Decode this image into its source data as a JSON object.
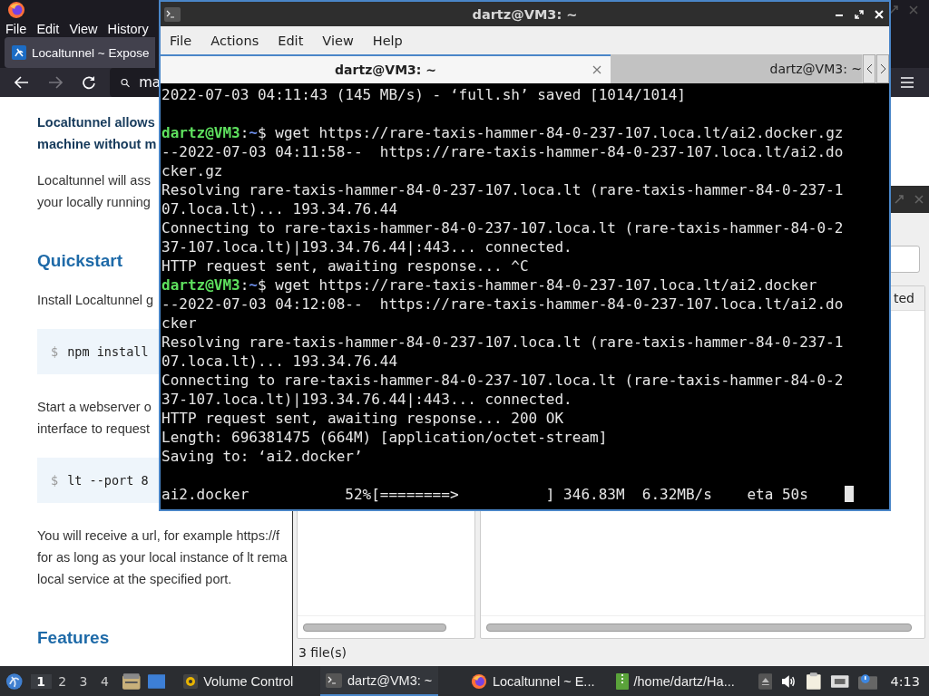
{
  "browser": {
    "menu": [
      "File",
      "Edit",
      "View",
      "History"
    ],
    "tab": {
      "title": "Localtunnel ~ Expose",
      "selected": true
    },
    "address": {
      "value": "ma"
    },
    "content": [
      {
        "kind": "lead",
        "lines": [
          "Localtunnel allows",
          "machine without m"
        ]
      },
      {
        "kind": "para",
        "lines": [
          "Localtunnel will ass",
          "your locally running"
        ]
      },
      {
        "kind": "heading",
        "text": "Quickstart"
      },
      {
        "kind": "para",
        "lines": [
          "Install Localtunnel g"
        ]
      },
      {
        "kind": "code",
        "prompt": "$",
        "text": "npm install"
      },
      {
        "kind": "para",
        "lines": [
          "Start a webserver o",
          "interface to request"
        ]
      },
      {
        "kind": "code",
        "prompt": "$",
        "text": "lt --port 8"
      },
      {
        "kind": "para",
        "lines": [
          "You will receive a url, for example https://f",
          "for as long as your local instance of lt rema",
          "local service at the specified port."
        ]
      },
      {
        "kind": "heading",
        "text": "Features"
      }
    ]
  },
  "file_manager": {
    "column_header": "ted",
    "status": "3 file(s)"
  },
  "terminal": {
    "title": "dartz@VM3: ~",
    "menu": [
      "File",
      "Actions",
      "Edit",
      "View",
      "Help"
    ],
    "tabs": [
      {
        "label": "dartz@VM3: ~",
        "selected": true
      },
      {
        "label": "dartz@VM3: ~",
        "selected": false
      }
    ],
    "cursor_visible": true,
    "lines": [
      {
        "kind": "text",
        "text": "2022-07-03 04:11:43 (145 MB/s) - ‘full.sh’ saved [1014/1014]"
      },
      {
        "kind": "blank"
      },
      {
        "kind": "prompt",
        "user": "dartz@VM3",
        "separator": ":",
        "path": "~",
        "symbol": "$",
        "command": "wget https://rare-taxis-hammer-84-0-237-107.loca.lt/ai2.docker.gz"
      },
      {
        "kind": "text",
        "text": "--2022-07-03 04:11:58--  https://rare-taxis-hammer-84-0-237-107.loca.lt/ai2.do"
      },
      {
        "kind": "text",
        "text": "cker.gz"
      },
      {
        "kind": "text",
        "text": "Resolving rare-taxis-hammer-84-0-237-107.loca.lt (rare-taxis-hammer-84-0-237-1"
      },
      {
        "kind": "text",
        "text": "07.loca.lt)... 193.34.76.44"
      },
      {
        "kind": "text",
        "text": "Connecting to rare-taxis-hammer-84-0-237-107.loca.lt (rare-taxis-hammer-84-0-2"
      },
      {
        "kind": "text",
        "text": "37-107.loca.lt)|193.34.76.44|:443... connected."
      },
      {
        "kind": "text",
        "text": "HTTP request sent, awaiting response... ^C"
      },
      {
        "kind": "prompt",
        "user": "dartz@VM3",
        "separator": ":",
        "path": "~",
        "symbol": "$",
        "command": "wget https://rare-taxis-hammer-84-0-237-107.loca.lt/ai2.docker"
      },
      {
        "kind": "text",
        "text": "--2022-07-03 04:12:08--  https://rare-taxis-hammer-84-0-237-107.loca.lt/ai2.do"
      },
      {
        "kind": "text",
        "text": "cker"
      },
      {
        "kind": "text",
        "text": "Resolving rare-taxis-hammer-84-0-237-107.loca.lt (rare-taxis-hammer-84-0-237-1"
      },
      {
        "kind": "text",
        "text": "07.loca.lt)... 193.34.76.44"
      },
      {
        "kind": "text",
        "text": "Connecting to rare-taxis-hammer-84-0-237-107.loca.lt (rare-taxis-hammer-84-0-2"
      },
      {
        "kind": "text",
        "text": "37-107.loca.lt)|193.34.76.44|:443... connected."
      },
      {
        "kind": "text",
        "text": "HTTP request sent, awaiting response... 200 OK"
      },
      {
        "kind": "text",
        "text": "Length: 696381475 (664M) [application/octet-stream]"
      },
      {
        "kind": "text",
        "text": "Saving to: ‘ai2.docker’"
      },
      {
        "kind": "blank"
      },
      {
        "kind": "progress",
        "text": "ai2.docker           52%[========>          ] 346.83M  6.32MB/s    eta 50s"
      }
    ]
  },
  "taskbar": {
    "workspaces": [
      {
        "label": "1",
        "selected": true
      },
      {
        "label": "2",
        "selected": false
      },
      {
        "label": "3",
        "selected": false
      },
      {
        "label": "4",
        "selected": false
      }
    ],
    "tasks": [
      {
        "kind": "volume",
        "label": "Volume Control",
        "selected": false
      },
      {
        "kind": "terminal",
        "label": "dartz@VM3: ~",
        "selected": true
      },
      {
        "kind": "firefox",
        "label": "Localtunnel ~ E...",
        "selected": false
      },
      {
        "kind": "archive",
        "label": "/home/dartz/Ha...",
        "selected": false
      }
    ],
    "clock": "4:13"
  }
}
